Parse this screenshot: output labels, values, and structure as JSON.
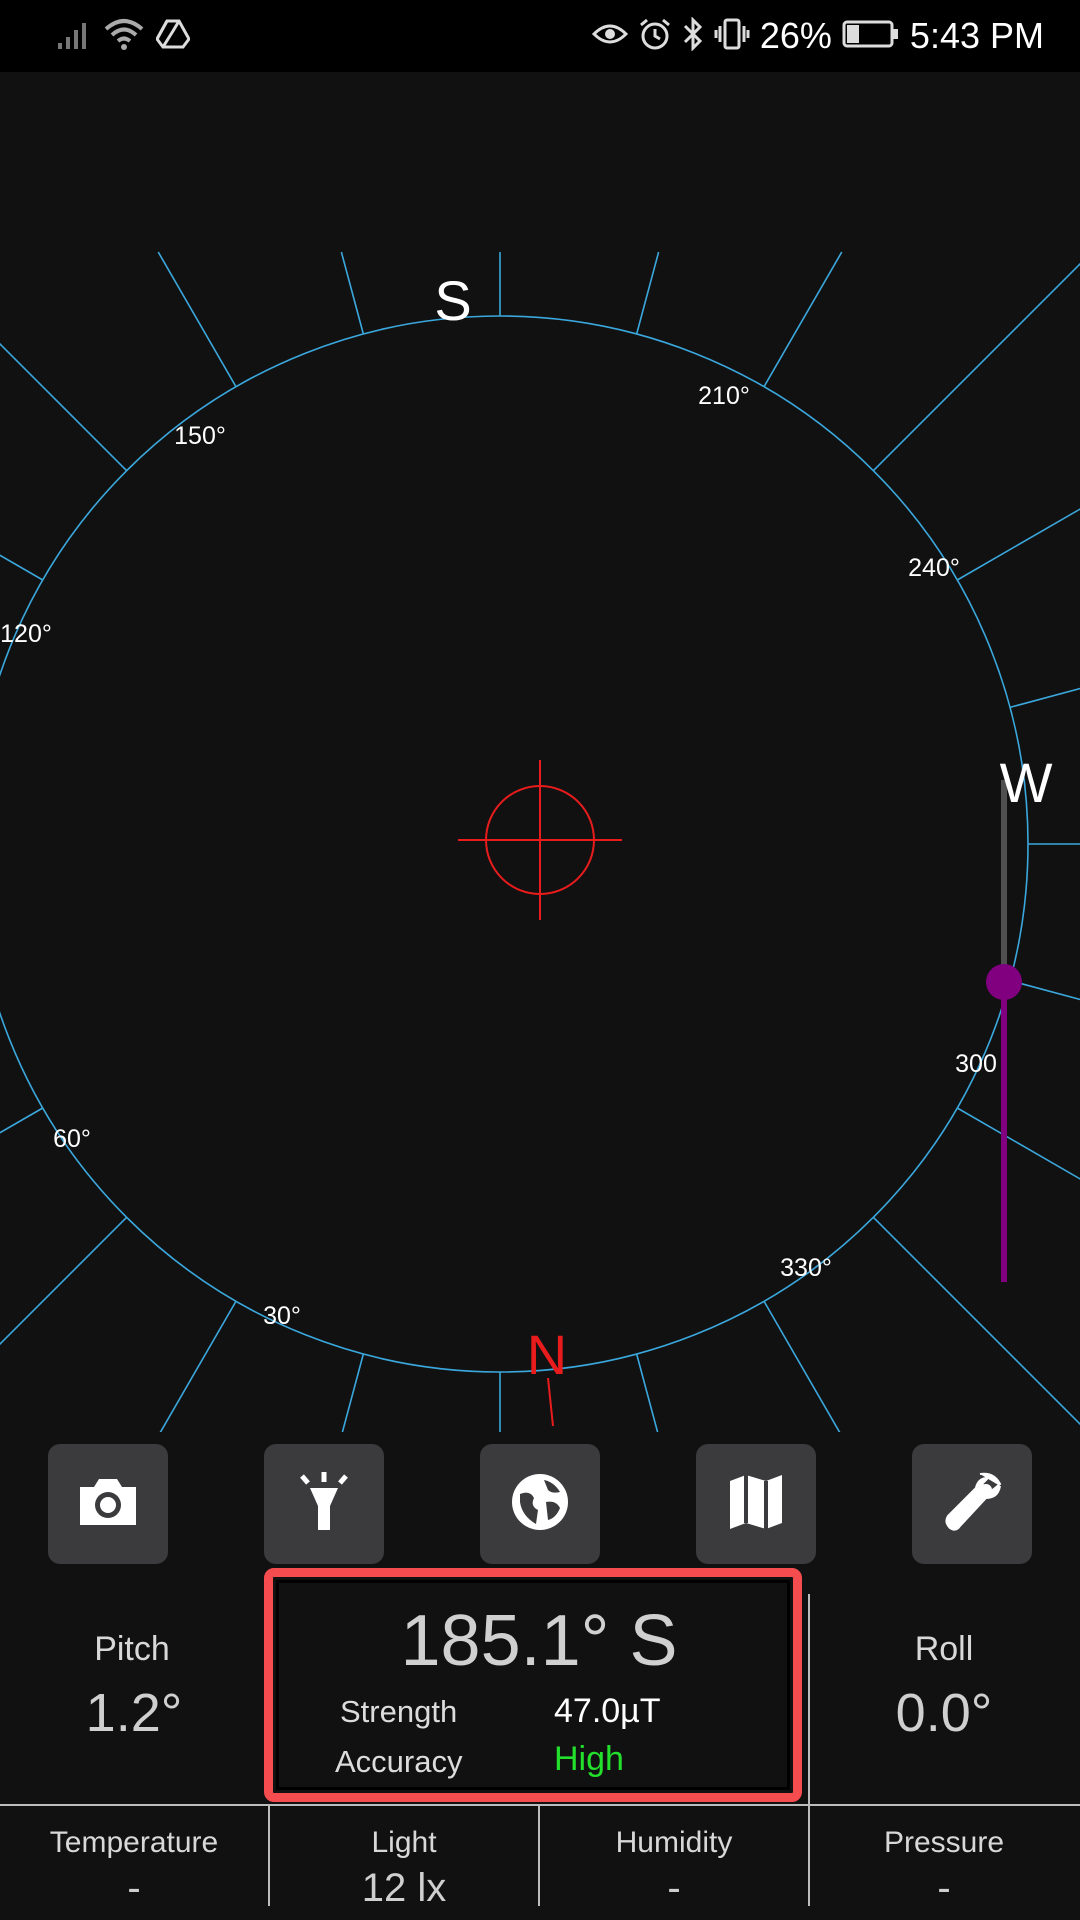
{
  "status_bar": {
    "battery": "26%",
    "time": "5:43 PM",
    "icons_left": [
      "signal-icon",
      "wifi-icon",
      "drive-icon"
    ],
    "icons_right": [
      "eye-icon",
      "alarm-icon",
      "bluetooth-icon",
      "vibrate-icon",
      "battery-icon"
    ]
  },
  "compass": {
    "cardinals": {
      "south": "S",
      "west": "W",
      "north": "N"
    },
    "degree_labels": [
      "30°",
      "60°",
      "120°",
      "150°",
      "210°",
      "240°",
      "300",
      "330°"
    ],
    "colors": {
      "ring": "#3ba8dd",
      "crosshair": "#e81c1c",
      "north": "#e81c1c",
      "slider": "#800080"
    }
  },
  "tools": [
    {
      "name": "camera-icon"
    },
    {
      "name": "flashlight-icon"
    },
    {
      "name": "globe-icon"
    },
    {
      "name": "map-icon"
    },
    {
      "name": "wrench-icon"
    }
  ],
  "readout": {
    "pitch_label": "Pitch",
    "pitch_value": "1.2°",
    "roll_label": "Roll",
    "roll_value": "0.0°",
    "heading": "185.1° S",
    "strength_label": "Strength",
    "strength_value": "47.0µT",
    "accuracy_label": "Accuracy",
    "accuracy_value": "High"
  },
  "environment": [
    {
      "label": "Temperature",
      "value": "-"
    },
    {
      "label": "Light",
      "value": "12 lx"
    },
    {
      "label": "Humidity",
      "value": "-"
    },
    {
      "label": "Pressure",
      "value": "-"
    }
  ]
}
